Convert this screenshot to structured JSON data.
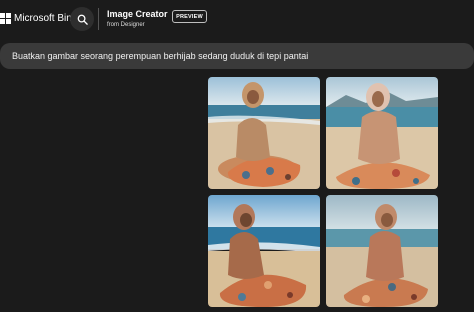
{
  "header": {
    "brand": "Microsoft Bing",
    "search_icon": "search-icon",
    "product_title": "Image Creator",
    "product_subtitle": "from Designer",
    "badge": "PREVIEW"
  },
  "prompt": {
    "text": "Buatkan gambar seorang perempuan berhijab sedang duduk di tepi pantai"
  },
  "results": {
    "images": [
      {
        "id": "result-1",
        "depicts": "woman in hijab sitting on beach"
      },
      {
        "id": "result-2",
        "depicts": "woman in hijab sitting on beach"
      },
      {
        "id": "result-3",
        "depicts": "woman in hijab sitting on beach"
      },
      {
        "id": "result-4",
        "depicts": "woman in hijab sitting on beach"
      }
    ]
  },
  "colors": {
    "page_bg": "#1b1b1b",
    "prompt_bg": "#3a3a3a",
    "search_btn_bg": "#2e2e2e"
  }
}
